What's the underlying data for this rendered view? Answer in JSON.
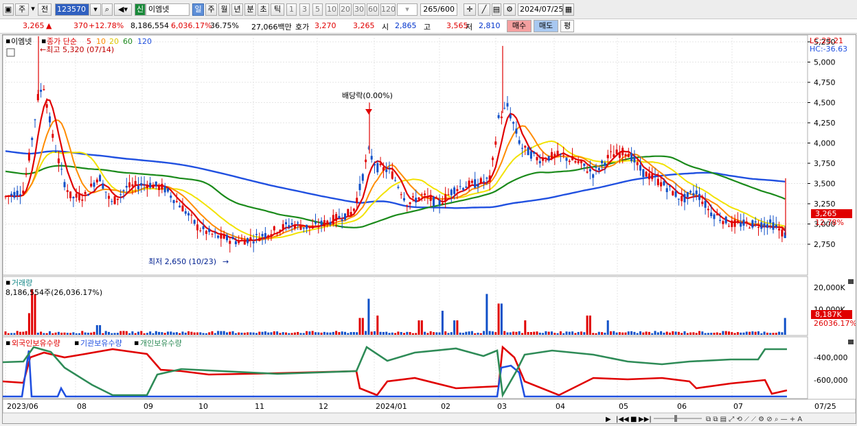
{
  "toolbar": {
    "market_label": "주",
    "prev_label": "전",
    "code_value": "123570",
    "new_badge": "신",
    "stock_name": "이엠넷",
    "periods": [
      "일",
      "주",
      "월",
      "년",
      "분",
      "초",
      "틱"
    ],
    "intervals": [
      "1",
      "3",
      "5",
      "10",
      "20",
      "30",
      "60",
      "120"
    ],
    "count_value": "265",
    "count_total": "/600",
    "date_value": "2024/07/25"
  },
  "info": {
    "price": "3,265",
    "arrow": "▲",
    "change": "370",
    "change_pct": "+12.78%",
    "volume": "8,186,554",
    "volume_pct": "6,036.17%",
    "ratio": "36.75%",
    "amount": "27,066백만",
    "hoga_label": "호가",
    "hoga_ask": "3,270",
    "hoga_bid": "3,265",
    "open_label": "시",
    "open": "2,865",
    "high_label": "고",
    "high": "3,565",
    "low_label": "저",
    "low": "2,810",
    "buy_label": "매수",
    "sell_label": "매도",
    "eval_label": "평"
  },
  "price_panel": {
    "name": "이엠넷",
    "ma_label": "종가 단순",
    "ma_periods": [
      "5",
      "10",
      "20",
      "60",
      "120"
    ],
    "ma_colors": [
      "#e00000",
      "#ff8c00",
      "#f2e200",
      "#1a8a1a",
      "#2050e0"
    ],
    "lc": "LC:23.21",
    "hc": "HC:-36.63",
    "high_note": "←최고 5,320 (07/14)",
    "low_note": "최저 2,650 (10/23)",
    "dividend_note": "배당락(0.00%)",
    "last_price": "3,265",
    "last_pct": "12.78%",
    "y_ticks": [
      "5,250",
      "5,000",
      "4,750",
      "4,500",
      "4,250",
      "4,000",
      "3,750",
      "3,500",
      "3,250",
      "3,000",
      "2,750"
    ]
  },
  "volume_panel": {
    "title": "거래량",
    "value": "8,186,554주(26,036.17%)",
    "y_ticks": [
      "20,000K",
      "10,000K"
    ],
    "last_value": "8,187K",
    "last_pct": "26036.17%"
  },
  "holding_panel": {
    "series": [
      "외국인보유수량",
      "기관보유수량",
      "개인보유수량"
    ],
    "series_colors": [
      "#e00000",
      "#2050e0",
      "#2e8b57"
    ],
    "y_ticks": [
      "-400,000",
      "-600,000"
    ]
  },
  "x_axis": {
    "labels": [
      "2023/06",
      "08",
      "09",
      "10",
      "11",
      "12",
      "2024/01",
      "02",
      "03",
      "04",
      "05",
      "06",
      "07"
    ],
    "right_label": "07/25"
  }
}
